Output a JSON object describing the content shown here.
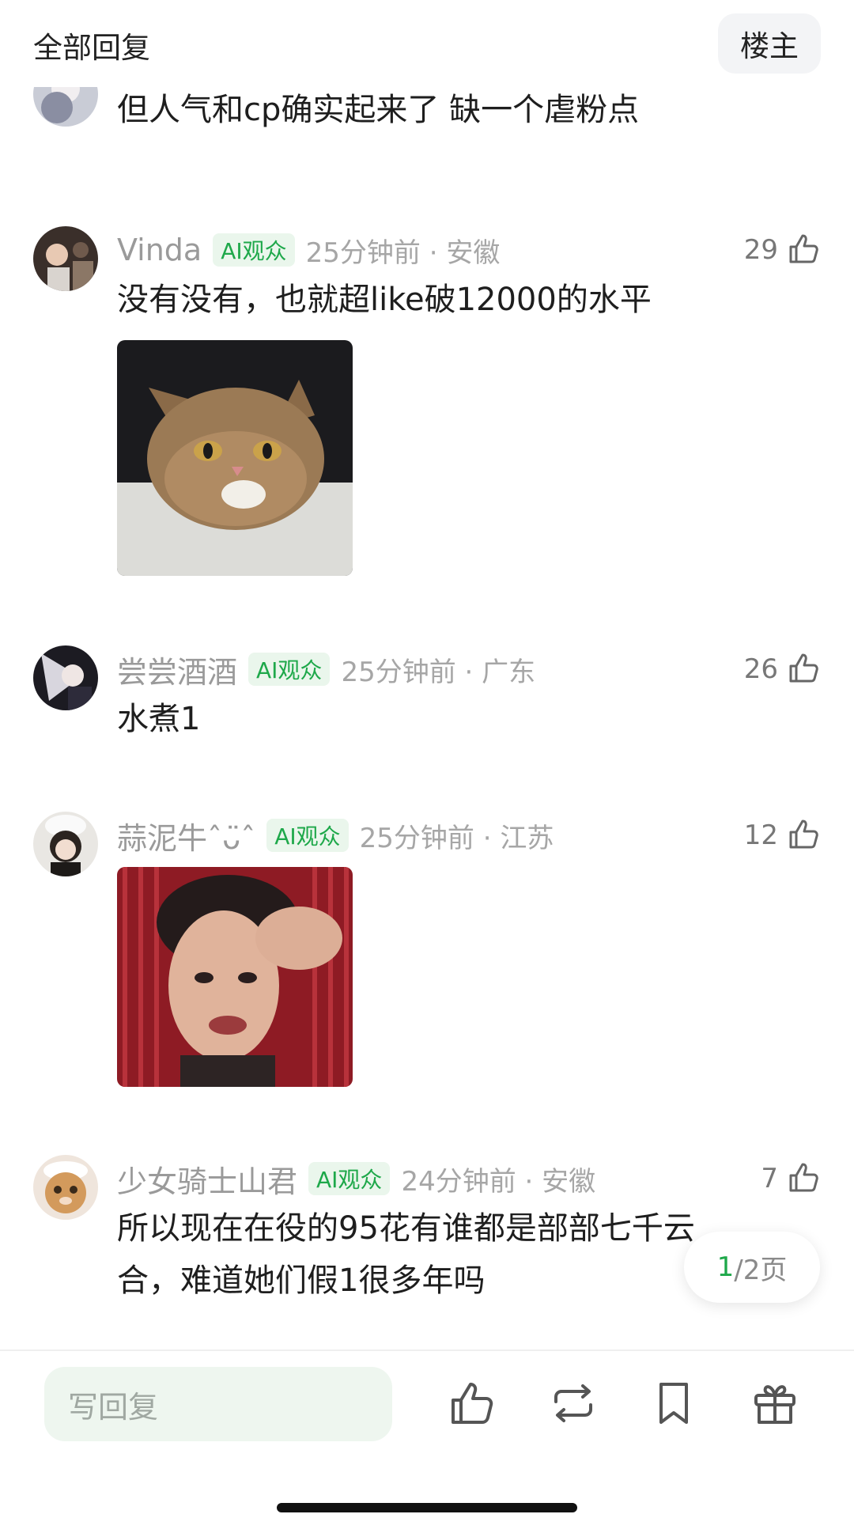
{
  "header": {
    "title": "全部回复",
    "owner_button": "楼主"
  },
  "comments": [
    {
      "text": "但人气和cp确实起来了 缺一个虐粉点"
    },
    {
      "username": "Vinda",
      "badge": "AI观众",
      "time_location": "25分钟前 · 安徽",
      "likes": "29",
      "text": "没有没有，也就超like破12000的水平",
      "media": "cat-photo"
    },
    {
      "username": "尝尝酒酒",
      "badge": "AI观众",
      "time_location": "25分钟前 · 广东",
      "likes": "26",
      "text": "水煮1"
    },
    {
      "username": "蒜泥牛ˆᴗ̈ˆ",
      "badge": "AI观众",
      "time_location": "25分钟前 · 江苏",
      "likes": "12",
      "media": "woman-reaction-photo"
    },
    {
      "username": "少女骑士山君",
      "badge": "AI观众",
      "time_location": "24分钟前 · 安徽",
      "likes": "7",
      "text_line1": "所以现在在役的95花有谁都是部部七千云",
      "text_line2": "合，难道她们假1很多年吗"
    }
  ],
  "pager": {
    "current": "1",
    "total_label": "/2页"
  },
  "bottom_bar": {
    "reply_placeholder": "写回复",
    "icons": [
      "thumbs-up-icon",
      "repost-icon",
      "bookmark-icon",
      "gift-icon"
    ]
  },
  "colors": {
    "accent": "#1ea84a",
    "badge_bg": "#eaf6ec",
    "input_bg": "#eef6ef"
  }
}
